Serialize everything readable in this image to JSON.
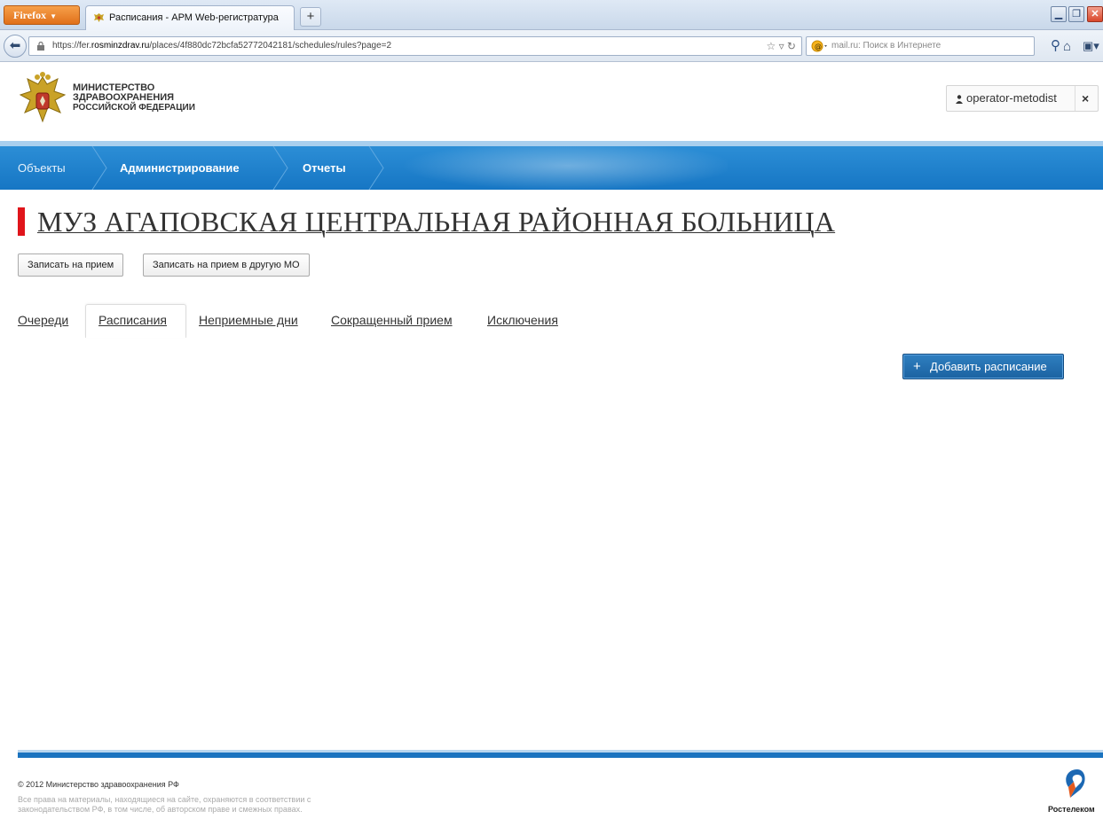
{
  "browser": {
    "app_button": "Firefox",
    "tab_title": "Расписания - АРМ Web-регистратура",
    "new_tab": "+",
    "url_prefix": "https://fer.",
    "url_host": "rosminzdrav.ru",
    "url_path": "/places/4f880dc72bcfa52772042181/schedules/rules?page=2",
    "search_placeholder": "mail.ru: Поиск в Интернете"
  },
  "header": {
    "ministry_line1": "МИНИСТЕРСТВО",
    "ministry_line2": "ЗДРАВООХРАНЕНИЯ",
    "ministry_line3": "РОССИЙСКОЙ ФЕДЕРАЦИИ",
    "user_name": "operator-metodist",
    "logout": "×"
  },
  "menu": {
    "items": [
      {
        "label": "Объекты"
      },
      {
        "label": "Администрирование"
      },
      {
        "label": "Отчеты"
      }
    ]
  },
  "page": {
    "title": "МУЗ АГАПОВСКАЯ ЦЕНТРАЛЬНАЯ РАЙОННАЯ БОЛЬНИЦА",
    "actions": {
      "appoint": "Записать на прием",
      "appoint_other": "Записать на прием в другую МО"
    },
    "tabs": [
      {
        "label": "Очереди"
      },
      {
        "label": "Расписания",
        "active": true
      },
      {
        "label": "Неприемные дни"
      },
      {
        "label": "Сокращенный прием"
      },
      {
        "label": "Исключения"
      }
    ],
    "add_schedule": "Добавить расписание"
  },
  "footer": {
    "copyright": "© 2012 Министерство здравоохранения РФ",
    "rights_line1": "Все права на материалы, находящиеся на сайте, охраняются в соответствии с",
    "rights_line2": "законодательством РФ, в том числе, об авторском праве и смежных правах.",
    "company": "Ростелеком"
  },
  "colors": {
    "menu_blue": "#1676c4",
    "title_accent": "#e0151b",
    "primary_button": "#1b62a1"
  }
}
